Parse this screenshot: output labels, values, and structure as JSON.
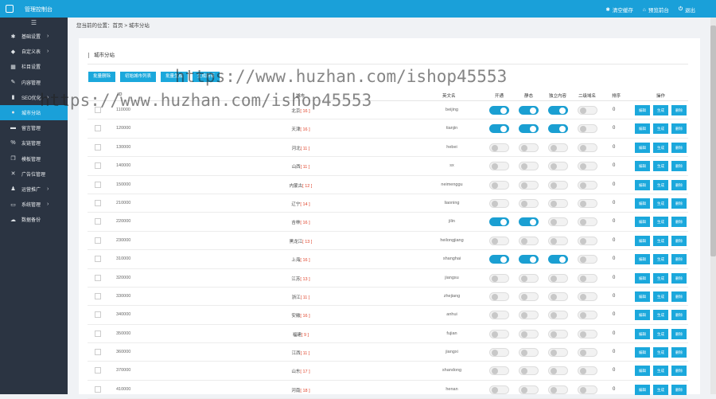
{
  "topbar": {
    "title": "管理控制台",
    "links": [
      {
        "icon": "gear-icon",
        "label": "清空缓存"
      },
      {
        "icon": "home-icon",
        "label": "预览前台"
      },
      {
        "icon": "power-icon",
        "label": "退出"
      }
    ]
  },
  "sidebar": {
    "toggle": "☰",
    "items": [
      {
        "icon": "gear-icon",
        "glyph": "✱",
        "label": "基础设置",
        "arrow": "›"
      },
      {
        "icon": "tag-icon",
        "glyph": "◆",
        "label": "自定义表",
        "arrow": "›"
      },
      {
        "icon": "grid-icon",
        "glyph": "▦",
        "label": "栏目设置",
        "arrow": ""
      },
      {
        "icon": "edit-icon",
        "glyph": "✎",
        "label": "内容管理",
        "arrow": ""
      },
      {
        "icon": "chart-icon",
        "glyph": "▮",
        "label": "SEO优化",
        "arrow": "›"
      },
      {
        "icon": "globe-icon",
        "glyph": "●",
        "label": "城市分站",
        "arrow": ""
      },
      {
        "icon": "comment-icon",
        "glyph": "▬",
        "label": "留言管理",
        "arrow": ""
      },
      {
        "icon": "link-icon",
        "glyph": "%",
        "label": "友链管理",
        "arrow": ""
      },
      {
        "icon": "copy-icon",
        "glyph": "❐",
        "label": "模板管理",
        "arrow": ""
      },
      {
        "icon": "close-box-icon",
        "glyph": "✕",
        "label": "广告位管理",
        "arrow": ""
      },
      {
        "icon": "user-icon",
        "glyph": "♟",
        "label": "运营推广",
        "arrow": "›"
      },
      {
        "icon": "monitor-icon",
        "glyph": "▭",
        "label": "系统管理",
        "arrow": "›"
      },
      {
        "icon": "cloud-icon",
        "glyph": "☁",
        "label": "数据备份",
        "arrow": ""
      }
    ]
  },
  "breadcrumb": "您当前的位置：首页 > 城市分站",
  "panel_title": "城市分站",
  "buttons": [
    "批量删除",
    "初始城市列表",
    "批量生成",
    "生成所有"
  ],
  "columns": [
    "ID",
    "城市",
    "英文名",
    "开通",
    "静态",
    "独立内容",
    "二级域名",
    "排序",
    "操作"
  ],
  "actions": [
    "编辑",
    "生成",
    "删除"
  ],
  "rows": [
    {
      "code": "110000",
      "name": "北京",
      "count": "[ 16 ]",
      "en": "beijing",
      "open": true,
      "static": true,
      "indep": true,
      "sub": false,
      "sort": "0"
    },
    {
      "code": "120000",
      "name": "天津",
      "count": "[ 16 ]",
      "en": "tianjin",
      "open": true,
      "static": true,
      "indep": true,
      "sub": false,
      "sort": "0"
    },
    {
      "code": "130000",
      "name": "河北",
      "count": "[ 11 ]",
      "en": "hebei",
      "open": false,
      "static": false,
      "indep": false,
      "sub": false,
      "sort": "0"
    },
    {
      "code": "140000",
      "name": "山西",
      "count": "[ 11 ]",
      "en": "sx",
      "open": false,
      "static": false,
      "indep": false,
      "sub": false,
      "sort": "0"
    },
    {
      "code": "150000",
      "name": "内蒙古",
      "count": "[ 12 ]",
      "en": "neimenggu",
      "open": false,
      "static": false,
      "indep": false,
      "sub": false,
      "sort": "0"
    },
    {
      "code": "210000",
      "name": "辽宁",
      "count": "[ 14 ]",
      "en": "liaoning",
      "open": false,
      "static": false,
      "indep": false,
      "sub": false,
      "sort": "0"
    },
    {
      "code": "220000",
      "name": "吉林",
      "count": "[ 16 ]",
      "en": "jilin",
      "open": true,
      "static": true,
      "indep": false,
      "sub": false,
      "sort": "0"
    },
    {
      "code": "230000",
      "name": "黑龙江",
      "count": "[ 13 ]",
      "en": "heilongjiang",
      "open": false,
      "static": false,
      "indep": false,
      "sub": false,
      "sort": "0"
    },
    {
      "code": "310000",
      "name": "上海",
      "count": "[ 16 ]",
      "en": "shanghai",
      "open": true,
      "static": true,
      "indep": true,
      "sub": false,
      "sort": "0"
    },
    {
      "code": "320000",
      "name": "江苏",
      "count": "[ 13 ]",
      "en": "jiangsu",
      "open": false,
      "static": false,
      "indep": false,
      "sub": false,
      "sort": "0"
    },
    {
      "code": "330000",
      "name": "浙江",
      "count": "[ 11 ]",
      "en": "zhejiang",
      "open": false,
      "static": false,
      "indep": false,
      "sub": false,
      "sort": "0"
    },
    {
      "code": "340000",
      "name": "安徽",
      "count": "[ 16 ]",
      "en": "anhui",
      "open": false,
      "static": false,
      "indep": false,
      "sub": false,
      "sort": "0"
    },
    {
      "code": "350000",
      "name": "福建",
      "count": "[ 9 ]",
      "en": "fujian",
      "open": false,
      "static": false,
      "indep": false,
      "sub": false,
      "sort": "0"
    },
    {
      "code": "360000",
      "name": "江西",
      "count": "[ 11 ]",
      "en": "jiangxi",
      "open": false,
      "static": false,
      "indep": false,
      "sub": false,
      "sort": "0"
    },
    {
      "code": "370000",
      "name": "山东",
      "count": "[ 17 ]",
      "en": "shandong",
      "open": false,
      "static": false,
      "indep": false,
      "sub": false,
      "sort": "0"
    },
    {
      "code": "410000",
      "name": "河南",
      "count": "[ 18 ]",
      "en": "henan",
      "open": false,
      "static": false,
      "indep": false,
      "sub": false,
      "sort": "0"
    }
  ],
  "watermark": "https://www.huzhan.com/ishop45553",
  "colors": {
    "accent": "#1aa0d9",
    "sidebar": "#2b3442",
    "count": "#e0442b"
  }
}
